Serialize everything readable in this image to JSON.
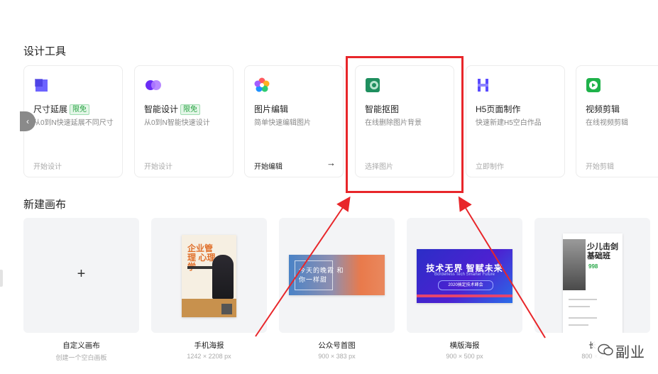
{
  "sections": {
    "tools_title": "设计工具",
    "canvas_title": "新建画布"
  },
  "tools": [
    {
      "name": "尺寸延展",
      "badge": "限免",
      "desc": "从0到N快速延展不同尺寸",
      "action": "开始设计",
      "icon": "purple-square-icon"
    },
    {
      "name": "智能设计",
      "badge": "限免",
      "desc": "从0到N智能快速设计",
      "action": "开始设计",
      "icon": "twin-circles-icon"
    },
    {
      "name": "图片编辑",
      "desc": "简单快速编辑图片",
      "action": "开始编辑",
      "icon": "color-flower-icon"
    },
    {
      "name": "智能抠图",
      "desc": "在线删除图片背景",
      "action": "选择图片",
      "icon": "cutout-icon"
    },
    {
      "name": "H5页面制作",
      "desc": "快速新建H5空白作品",
      "action": "立即制作",
      "icon": "h5-icon"
    },
    {
      "name": "视频剪辑",
      "desc": "在线视频剪辑",
      "action": "开始剪辑",
      "icon": "play-icon"
    }
  ],
  "canvases": [
    {
      "name": "自定义画布",
      "size": "创建一个空白画板"
    },
    {
      "name": "手机海报",
      "size": "1242 × 2208 px"
    },
    {
      "name": "公众号首图",
      "size": "900 × 383 px"
    },
    {
      "name": "横版海报",
      "size": "900 × 500 px"
    },
    {
      "name": "长",
      "size": "800 × 2"
    }
  ],
  "thumbs": {
    "poster_title": "企业管理 心理学",
    "wechat_text": "今天的晚霞 和你一样甜",
    "banner_title": "技术无界 智赋未来",
    "banner_sub": "Borderless Tech  Smarter Future",
    "banner_pill": "2020搞定技术峰会",
    "long_title": "少儿击剑 基础班",
    "long_price": "998"
  },
  "controls": {
    "scroll_left": "‹",
    "plus": "+",
    "arrow": "→"
  },
  "watermark": {
    "text": "副业"
  },
  "colors": {
    "highlight": "#e8262a",
    "badge_green": "#26a341"
  }
}
